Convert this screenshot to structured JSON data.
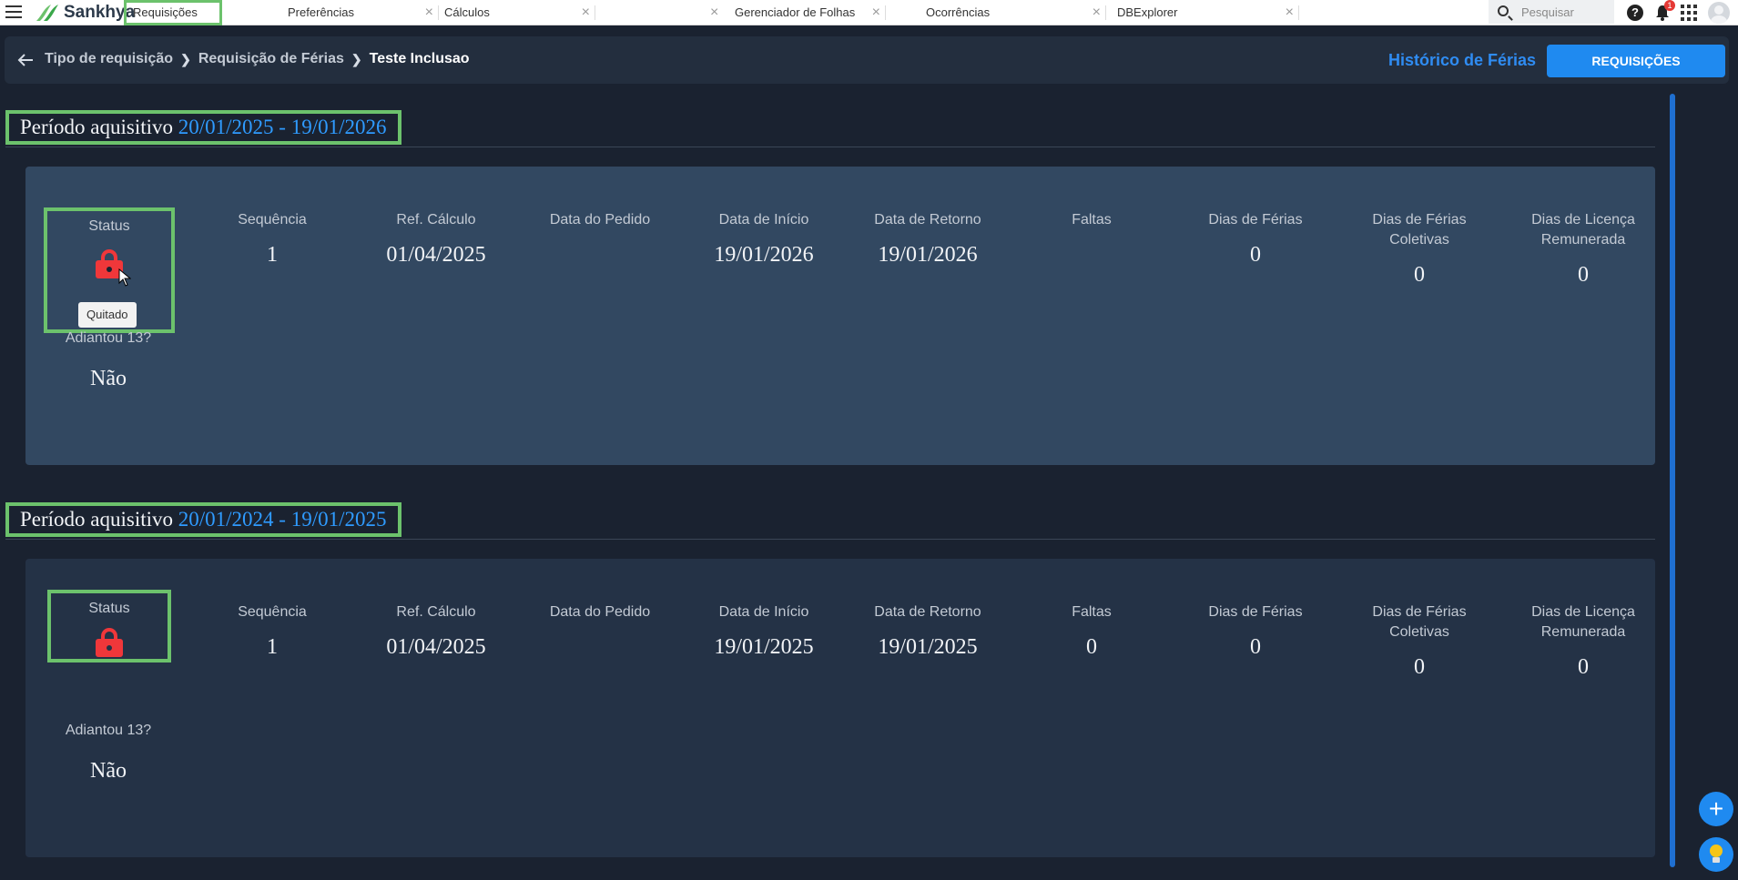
{
  "app": {
    "brand": "Sankhya"
  },
  "tabs": [
    {
      "label": "Requisições",
      "active": true
    },
    {
      "label": "Preferências"
    },
    {
      "label": "Cálculos"
    },
    {
      "label": "Gerenciador de Folhas"
    },
    {
      "label": "Ocorrências"
    },
    {
      "label": "DBExplorer"
    }
  ],
  "topbar": {
    "search_placeholder": "Pesquisar",
    "help": "?",
    "notification_count": "1"
  },
  "header": {
    "breadcrumb": [
      "Tipo de requisição",
      "Requisição de Férias",
      "Teste Inclusao"
    ],
    "history_link": "Histórico de Férias",
    "requisicoes_button": "REQUISIÇÕES"
  },
  "columns": {
    "status": "Status",
    "sequencia": "Sequência",
    "ref_calculo": "Ref. Cálculo",
    "data_pedido": "Data do Pedido",
    "data_inicio": "Data de Início",
    "data_retorno": "Data de Retorno",
    "faltas": "Faltas",
    "dias_ferias": "Dias de Férias",
    "dias_ferias_coletivas": "Dias de Férias Coletivas",
    "dias_licenca": "Dias de Licença Remunerada",
    "adiantou13": "Adiantou 13?"
  },
  "periods": [
    {
      "label": "Período aquisitivo",
      "range": "20/01/2025 - 19/01/2026",
      "status_tooltip": "Quitado",
      "sequencia": "1",
      "ref_calculo": "01/04/2025",
      "data_pedido": "",
      "data_inicio": "19/01/2026",
      "data_retorno": "19/01/2026",
      "faltas": "",
      "dias_ferias": "0",
      "dias_ferias_coletivas": "0",
      "dias_licenca": "0",
      "adiantou13": "Não"
    },
    {
      "label": "Período aquisitivo",
      "range": "20/01/2024 - 19/01/2025",
      "sequencia": "1",
      "ref_calculo": "01/04/2025",
      "data_pedido": "",
      "data_inicio": "19/01/2025",
      "data_retorno": "19/01/2025",
      "faltas": "0",
      "dias_ferias": "0",
      "dias_ferias_coletivas": "0",
      "dias_licenca": "0",
      "adiantou13": "Não"
    }
  ],
  "colors": {
    "accent": "#1f8af0",
    "highlight": "#6cc26c",
    "lock": "#f0373a",
    "range_text": "#2f9bff",
    "card1_bg": "#324861",
    "card2_bg": "#243246"
  }
}
